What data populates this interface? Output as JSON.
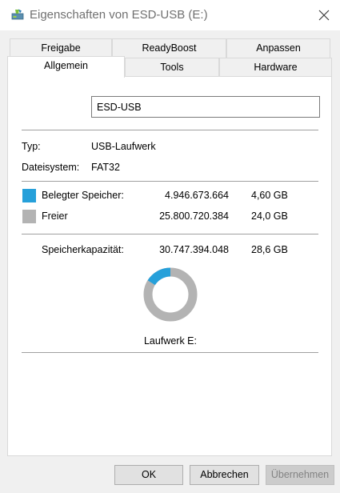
{
  "window": {
    "title": "Eigenschaften von ESD-USB (E:)",
    "title_color": "#707070"
  },
  "tabs": {
    "row1": [
      {
        "label": "Freigabe"
      },
      {
        "label": "ReadyBoost"
      },
      {
        "label": "Anpassen"
      }
    ],
    "row2": [
      {
        "label": "Allgemein",
        "active": true
      },
      {
        "label": "Tools"
      },
      {
        "label": "Hardware"
      }
    ]
  },
  "general": {
    "drive_name": "ESD-USB",
    "type_label": "Typ:",
    "type_value": "USB-Laufwerk",
    "fs_label": "Dateisystem:",
    "fs_value": "FAT32",
    "used": {
      "label": "Belegter Speicher:",
      "bytes": "4.946.673.664",
      "size": "4,60 GB",
      "color": "#26a0da"
    },
    "free": {
      "label": "Freier",
      "bytes": "25.800.720.384",
      "size": "24,0 GB",
      "color": "#b3b3b3"
    },
    "capacity": {
      "label": "Speicherkapazität:",
      "bytes": "30.747.394.048",
      "size": "28,6 GB"
    },
    "used_fraction": 0.161,
    "drive_caption": "Laufwerk E:"
  },
  "buttons": {
    "ok": "OK",
    "cancel": "Abbrechen",
    "apply": "Übernehmen"
  }
}
